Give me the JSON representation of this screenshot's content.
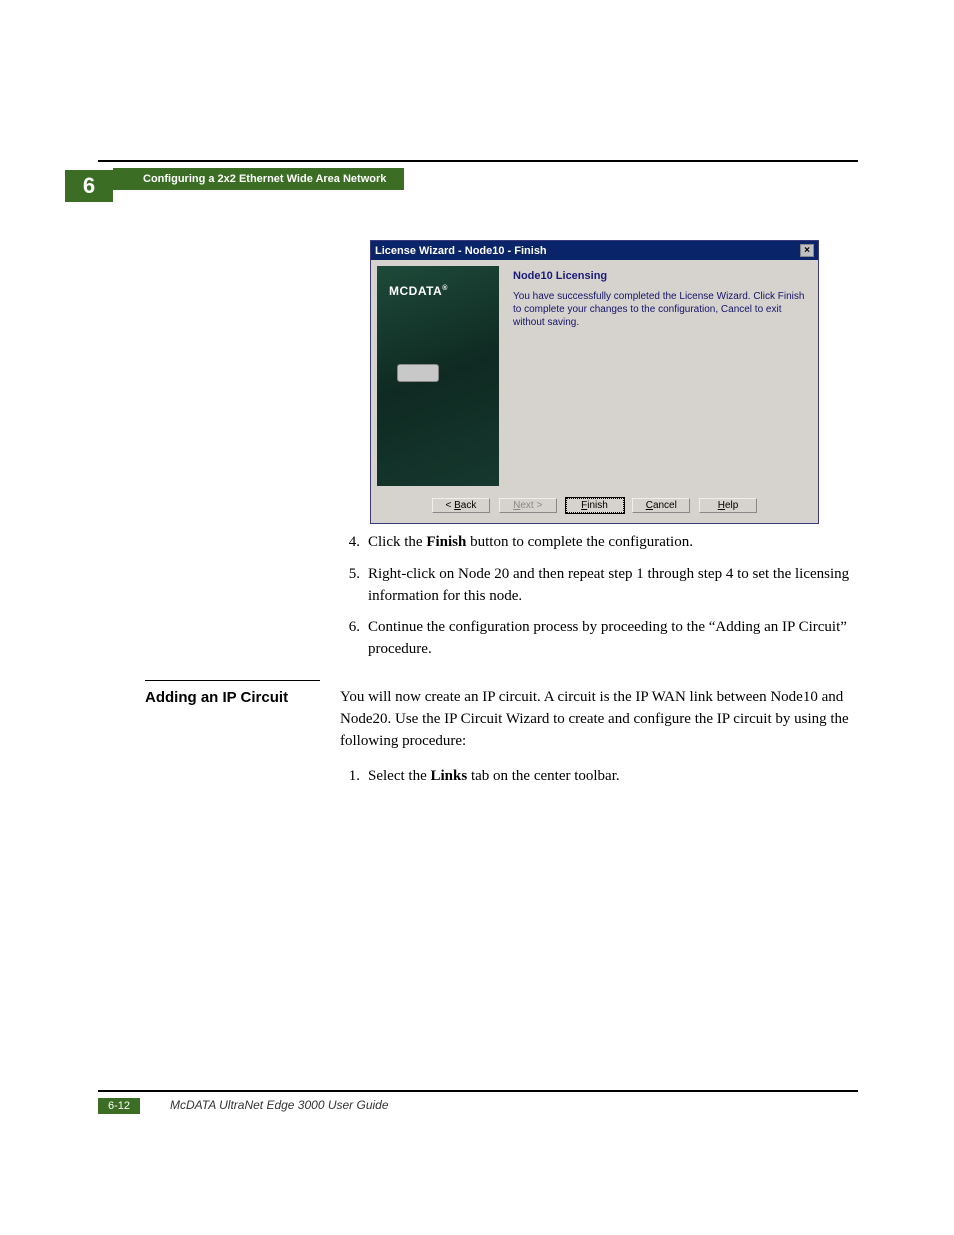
{
  "header": {
    "chapter_number": "6",
    "breadcrumb": "Configuring a 2x2 Ethernet Wide Area Network"
  },
  "wizard": {
    "title": "License Wizard - Node10 - Finish",
    "close_glyph": "×",
    "logo_text": "MCDATA",
    "heading": "Node10 Licensing",
    "body_text": "You have successfully completed the License Wizard. Click Finish to complete your changes to the configuration, Cancel to exit without saving.",
    "buttons": {
      "back_prefix": "< ",
      "back_ul": "B",
      "back_suffix": "ack",
      "next_ul": "N",
      "next_suffix": "ext >",
      "finish_ul": "F",
      "finish_suffix": "inish",
      "cancel_ul": "C",
      "cancel_suffix": "ancel",
      "help_ul": "H",
      "help_suffix": "elp"
    }
  },
  "steps_a": [
    {
      "num": "4.",
      "pre": "Click the ",
      "bold": "Finish",
      "post": " button to complete the configuration."
    },
    {
      "num": "5.",
      "pre": "Right-click on Node 20 and then repeat step 1 through step 4 to set the licensing information for this node.",
      "bold": "",
      "post": ""
    },
    {
      "num": "6.",
      "pre": "Continue the configuration process by proceeding to the “Adding an IP Circuit” procedure.",
      "bold": "",
      "post": ""
    }
  ],
  "section": {
    "title": "Adding an IP Circuit",
    "intro": "You will now create an IP circuit. A circuit is the IP WAN link between Node10 and Node20. Use the IP Circuit Wizard to create and configure the IP circuit by using the following procedure:",
    "steps": [
      {
        "num": "1.",
        "pre": "Select the ",
        "bold": "Links",
        "post": " tab on the center toolbar."
      }
    ]
  },
  "footer": {
    "page_ref": "6-12",
    "doc_title": "McDATA UltraNet Edge 3000 User Guide"
  }
}
